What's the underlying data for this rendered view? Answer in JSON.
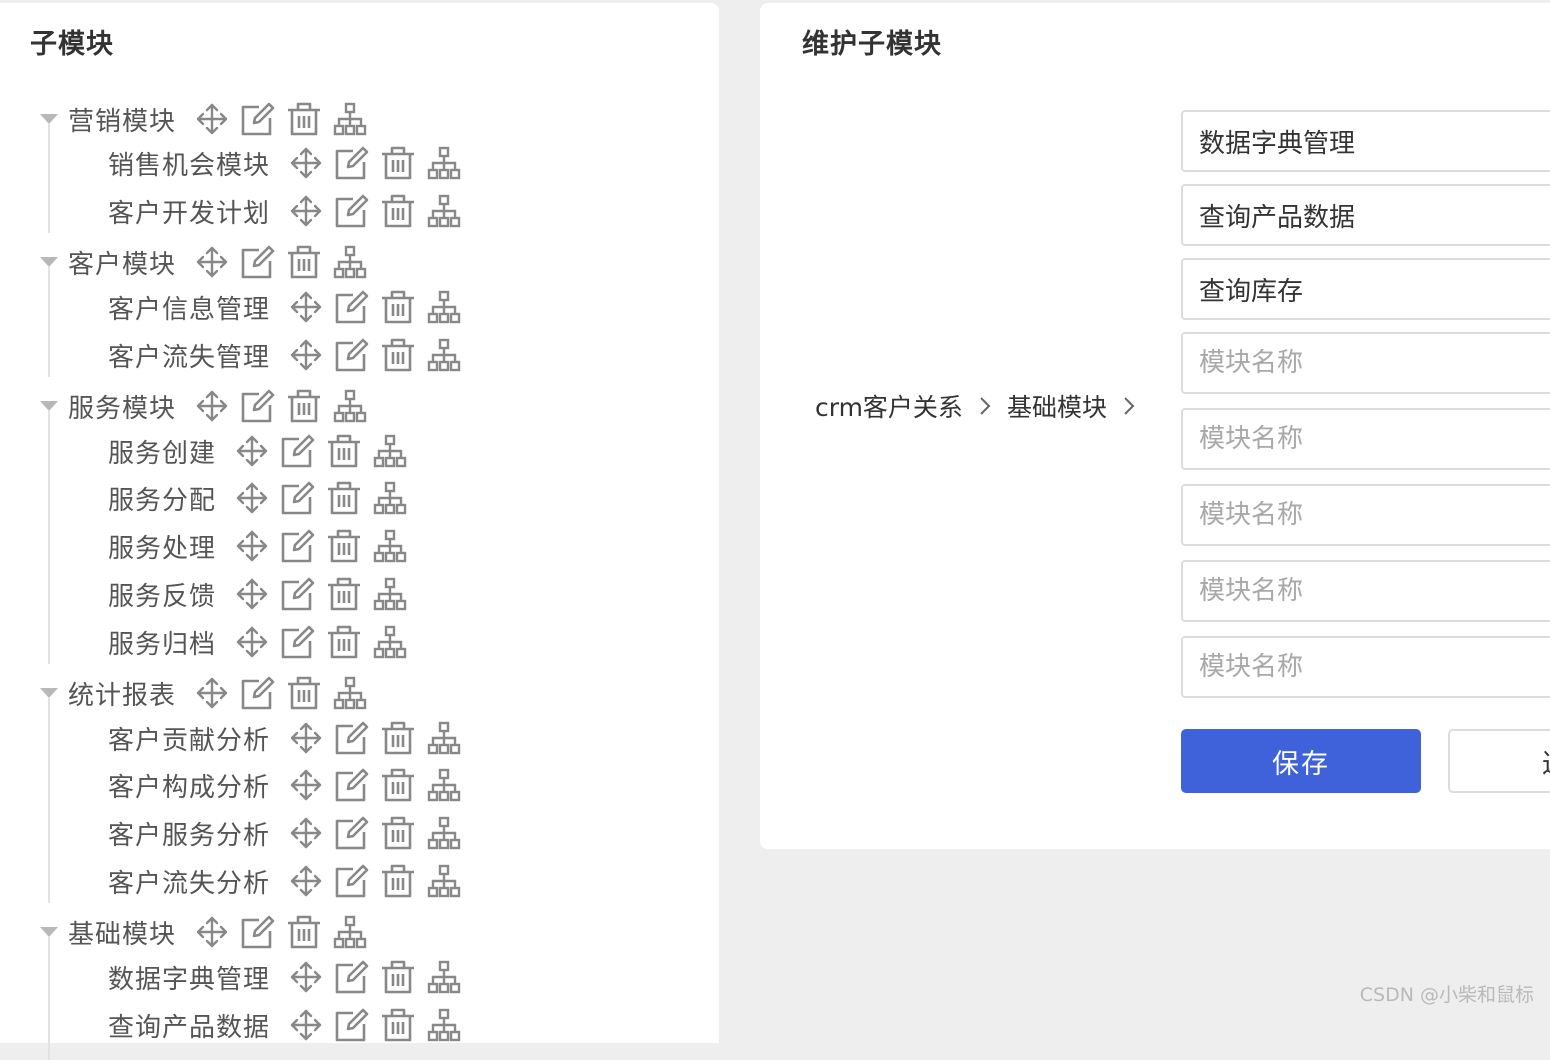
{
  "left_panel": {
    "title": "子模块",
    "tree": [
      {
        "label": "营销模块",
        "children": [
          {
            "label": "销售机会模块"
          },
          {
            "label": "客户开发计划"
          }
        ]
      },
      {
        "label": "客户模块",
        "children": [
          {
            "label": "客户信息管理"
          },
          {
            "label": "客户流失管理"
          }
        ]
      },
      {
        "label": "服务模块",
        "children": [
          {
            "label": "服务创建"
          },
          {
            "label": "服务分配"
          },
          {
            "label": "服务处理"
          },
          {
            "label": "服务反馈"
          },
          {
            "label": "服务归档"
          }
        ]
      },
      {
        "label": "统计报表",
        "children": [
          {
            "label": "客户贡献分析"
          },
          {
            "label": "客户构成分析"
          },
          {
            "label": "客户服务分析"
          },
          {
            "label": "客户流失分析"
          }
        ]
      },
      {
        "label": "基础模块",
        "children": [
          {
            "label": "数据字典管理"
          },
          {
            "label": "查询产品数据"
          }
        ]
      }
    ],
    "node_icons": [
      "move-icon",
      "edit-icon",
      "delete-icon",
      "sitemap-icon"
    ]
  },
  "right_panel": {
    "title": "维护子模块",
    "breadcrumb": [
      "crm客户关系",
      "基础模块"
    ],
    "fields": [
      {
        "value": "数据字典管理",
        "placeholder": "模块名称"
      },
      {
        "value": "查询产品数据",
        "placeholder": "模块名称"
      },
      {
        "value": "查询库存",
        "placeholder": "模块名称"
      },
      {
        "value": "",
        "placeholder": "模块名称"
      },
      {
        "value": "",
        "placeholder": "模块名称"
      },
      {
        "value": "",
        "placeholder": "模块名称"
      },
      {
        "value": "",
        "placeholder": "模块名称"
      },
      {
        "value": "",
        "placeholder": "模块名称"
      }
    ],
    "save_label": "保存",
    "second_label": "返"
  },
  "watermark": "CSDN @小柴和鼠标",
  "colors": {
    "primary": "#3f62db",
    "icon": "#888888",
    "background": "#eeeeee"
  }
}
